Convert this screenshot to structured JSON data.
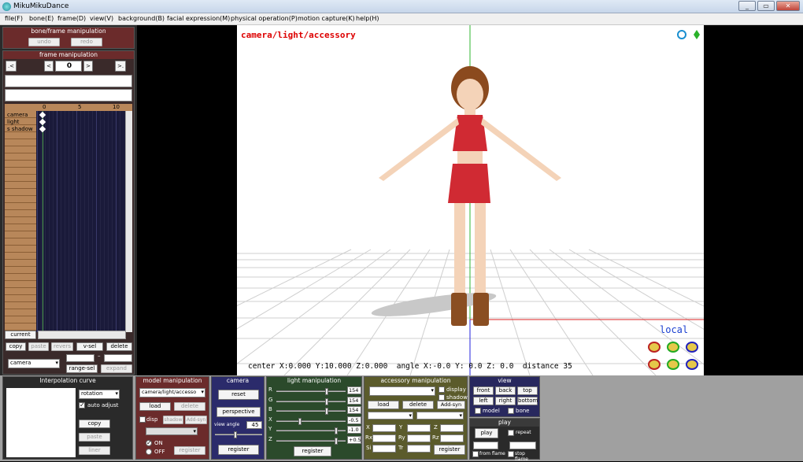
{
  "window": {
    "title": "MikuMikuDance",
    "controls": [
      "_",
      "▭",
      "✕"
    ]
  },
  "menu": [
    "file(F)",
    "bone(E)",
    "frame(D)",
    "view(V)",
    "background(B)",
    "facial expression(M)",
    "physical operation(P)",
    "motion capture(K)",
    "help(H)"
  ],
  "bone_frame": {
    "title": "bone/frame manipulation",
    "undo": "undo",
    "redo": "redo"
  },
  "frame": {
    "title": "frame manipulation",
    "prev_key": ".<",
    "prev": "<",
    "value": "0",
    "next": ">",
    "next_key": ">.",
    "ruler": [
      "0",
      "5",
      "10"
    ],
    "tracks": [
      "camera",
      "light",
      "s shadow"
    ],
    "current": "current",
    "copy": "copy",
    "paste": "paste",
    "revers": "revers",
    "vsel": "v-sel",
    "delete": "delete",
    "range_sel": "range-sel",
    "expand": "expand",
    "target": "camera",
    "dash": "–"
  },
  "interp": {
    "title": "Interpolation curve",
    "select": "rotation",
    "auto": "auto adjust",
    "copy": "copy",
    "paste": "paste",
    "liner": "liner"
  },
  "model": {
    "title": "model manipulation",
    "select": "camera/light/accesso",
    "load": "load",
    "delete": "delete",
    "disp": "disp",
    "shadow": "shadow",
    "addsyn": "Add-syn",
    "on": "ON",
    "off": "OFF",
    "register": "register"
  },
  "camera": {
    "title": "camera",
    "reset": "reset",
    "perspective": "perspective",
    "view_angle_label": "view angle",
    "view_angle": "45",
    "register": "register"
  },
  "light": {
    "title": "light manipulation",
    "rows": [
      {
        "l": "R",
        "v": "154"
      },
      {
        "l": "G",
        "v": "154"
      },
      {
        "l": "B",
        "v": "154"
      },
      {
        "l": "X",
        "v": "-0.5"
      },
      {
        "l": "Y",
        "v": "-1.0"
      },
      {
        "l": "Z",
        "v": "+0.5"
      }
    ],
    "register": "register"
  },
  "accessory": {
    "title": "accessory manipulation",
    "display": "display",
    "shadow": "shadow",
    "load": "load",
    "delete": "delete",
    "addsyn": "Add-syn",
    "labels": [
      "X",
      "Y",
      "Z",
      "Rx",
      "Ry",
      "Rz",
      "Si",
      "Tr"
    ],
    "register": "register"
  },
  "view": {
    "title": "view",
    "front": "front",
    "back": "back",
    "top": "top",
    "left": "left",
    "right": "right",
    "bottom": "bottom",
    "model": "model",
    "bone": "bone"
  },
  "play": {
    "title": "play",
    "play": "play",
    "repeat": "repeat",
    "from": "from flame",
    "stop": "stop flame"
  },
  "viewport": {
    "mode": "camera/light/accessory",
    "local": "local",
    "status": "center X:0.000 Y:10.000 Z:0.000  angle X:-0.0 Y: 0.0 Z: 0.0  distance 35"
  },
  "colors": {
    "panel_red": "#6b2b2b",
    "panel_navy": "#2b2b6b",
    "panel_green": "#2b4a2b",
    "panel_olive": "#5b5b2b",
    "panel_darkblue": "#28285e"
  }
}
